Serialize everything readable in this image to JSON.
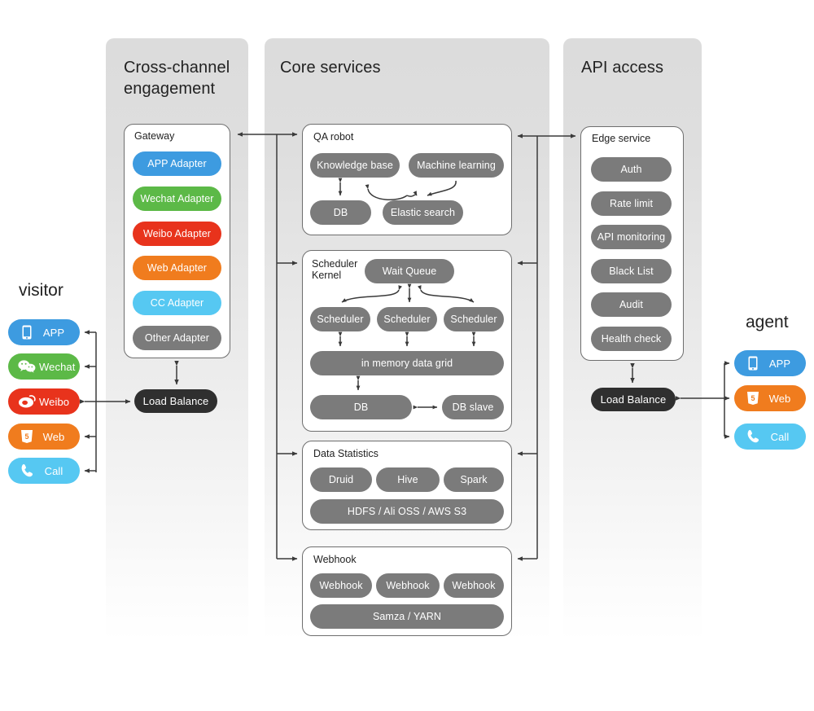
{
  "panels": [
    {
      "key": "cross",
      "title": "Cross-channel\nengagement"
    },
    {
      "key": "core",
      "title": "Core services"
    },
    {
      "key": "api",
      "title": "API access"
    }
  ],
  "gateway": {
    "title": "Gateway",
    "items": [
      {
        "label": "APP Adapter",
        "color": "#3d9be0"
      },
      {
        "label": "Wechat Adapter",
        "color": "#5cb947"
      },
      {
        "label": "Weibo Adapter",
        "color": "#e8331c"
      },
      {
        "label": "Web Adapter",
        "color": "#f07c1e"
      },
      {
        "label": "CC Adapter",
        "color": "#56c8f2"
      },
      {
        "label": "Other Adapter",
        "color": "#7b7b7b"
      }
    ]
  },
  "load_balance_left": {
    "label": "Load Balance"
  },
  "load_balance_right": {
    "label": "Load Balance"
  },
  "qa_robot": {
    "title": "QA robot",
    "nodes": [
      {
        "label": "Knowledge base"
      },
      {
        "label": "Machine learning"
      },
      {
        "label": "DB"
      },
      {
        "label": "Elastic search"
      }
    ]
  },
  "scheduler_kernel": {
    "title": "Scheduler\nKernel",
    "wait_queue": "Wait Queue",
    "schedulers": [
      "Scheduler",
      "Scheduler",
      "Scheduler"
    ],
    "data_grid": "in  memory data grid",
    "db": "DB",
    "db_slave": "DB slave"
  },
  "data_statistics": {
    "title": "Data Statistics",
    "engines": [
      "Druid",
      "Hive",
      "Spark"
    ],
    "storage": "HDFS / Ali OSS / AWS S3"
  },
  "webhook": {
    "title": "Webhook",
    "nodes": [
      "Webhook",
      "Webhook",
      "Webhook"
    ],
    "runtime": "Samza / YARN"
  },
  "edge_service": {
    "title": "Edge service",
    "items": [
      "Auth",
      "Rate limit",
      "API monitoring",
      "Black List",
      "Audit",
      "Health check"
    ]
  },
  "visitor": {
    "title": "visitor",
    "channels": [
      {
        "label": "APP",
        "icon": "mobile-icon",
        "color": "#3d9be0"
      },
      {
        "label": "Wechat",
        "icon": "wechat-icon",
        "color": "#5cb947"
      },
      {
        "label": "Weibo",
        "icon": "weibo-icon",
        "color": "#e8331c"
      },
      {
        "label": "Web",
        "icon": "html5-icon",
        "color": "#f07c1e"
      },
      {
        "label": "Call",
        "icon": "phone-icon",
        "color": "#56c8f2"
      }
    ]
  },
  "agent": {
    "title": "agent",
    "channels": [
      {
        "label": "APP",
        "icon": "mobile-icon",
        "color": "#3d9be0"
      },
      {
        "label": "Web",
        "icon": "html5-icon",
        "color": "#f07c1e"
      },
      {
        "label": "Call",
        "icon": "phone-icon",
        "color": "#56c8f2"
      }
    ]
  }
}
